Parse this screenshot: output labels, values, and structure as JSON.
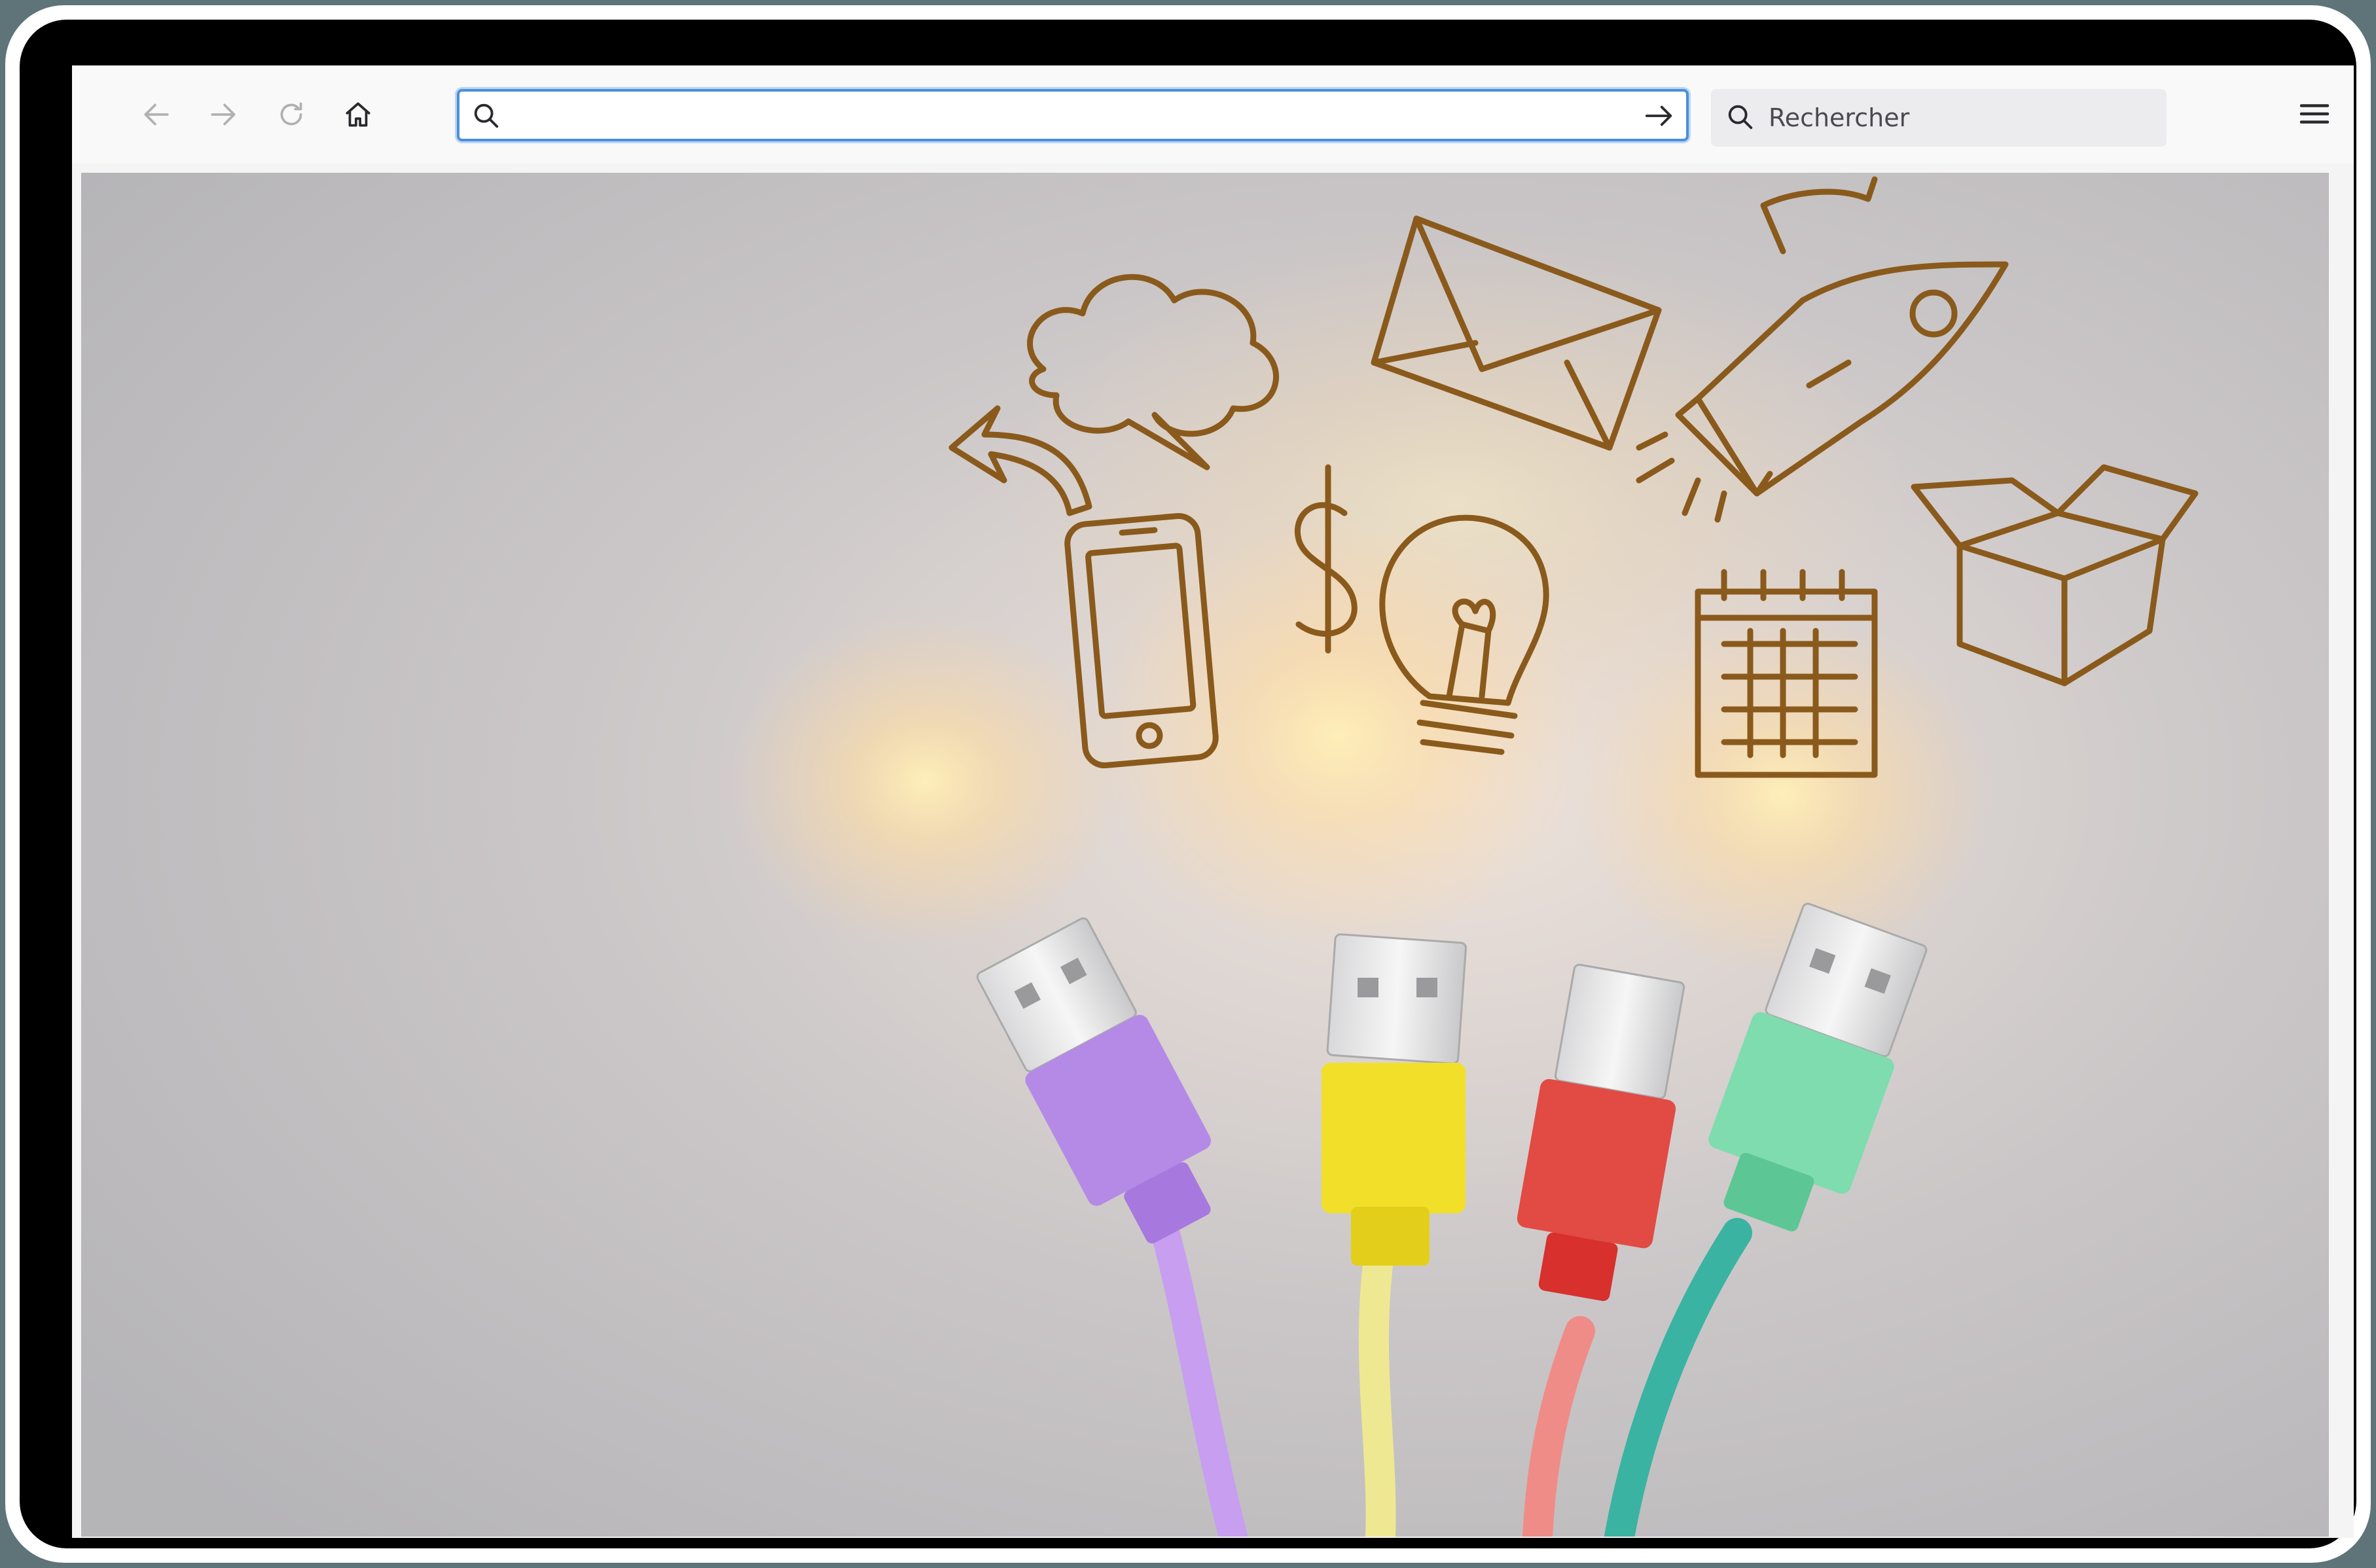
{
  "browser": {
    "toolbar": {
      "back_icon": "arrow-left-icon",
      "forward_icon": "arrow-right-icon",
      "reload_icon": "reload-icon",
      "home_icon": "home-icon",
      "menu_icon": "hamburger-menu-icon"
    },
    "url_bar": {
      "value": "",
      "placeholder": "",
      "search_icon": "search-icon",
      "go_icon": "arrow-right-icon"
    },
    "search_box": {
      "placeholder": "Rechercher",
      "icon": "search-icon"
    }
  },
  "colors": {
    "url_bar_focus": "#4a90d9",
    "toolbar_bg": "#f9f9fa",
    "search_bg": "#ececee",
    "cable_purple": "#b48ae6",
    "cable_yellow": "#f2df2a",
    "cable_red": "#e24a44",
    "cable_green": "#7fdcae",
    "doodle_ink": "#8a5a1c"
  },
  "content_image": {
    "description_icons": [
      "cloud-doodle",
      "envelope-doodle",
      "rocket-doodle",
      "phone-doodle",
      "dollar-doodle",
      "lightbulb-doodle",
      "calendar-doodle",
      "box-doodle",
      "arrow-doodle"
    ]
  }
}
